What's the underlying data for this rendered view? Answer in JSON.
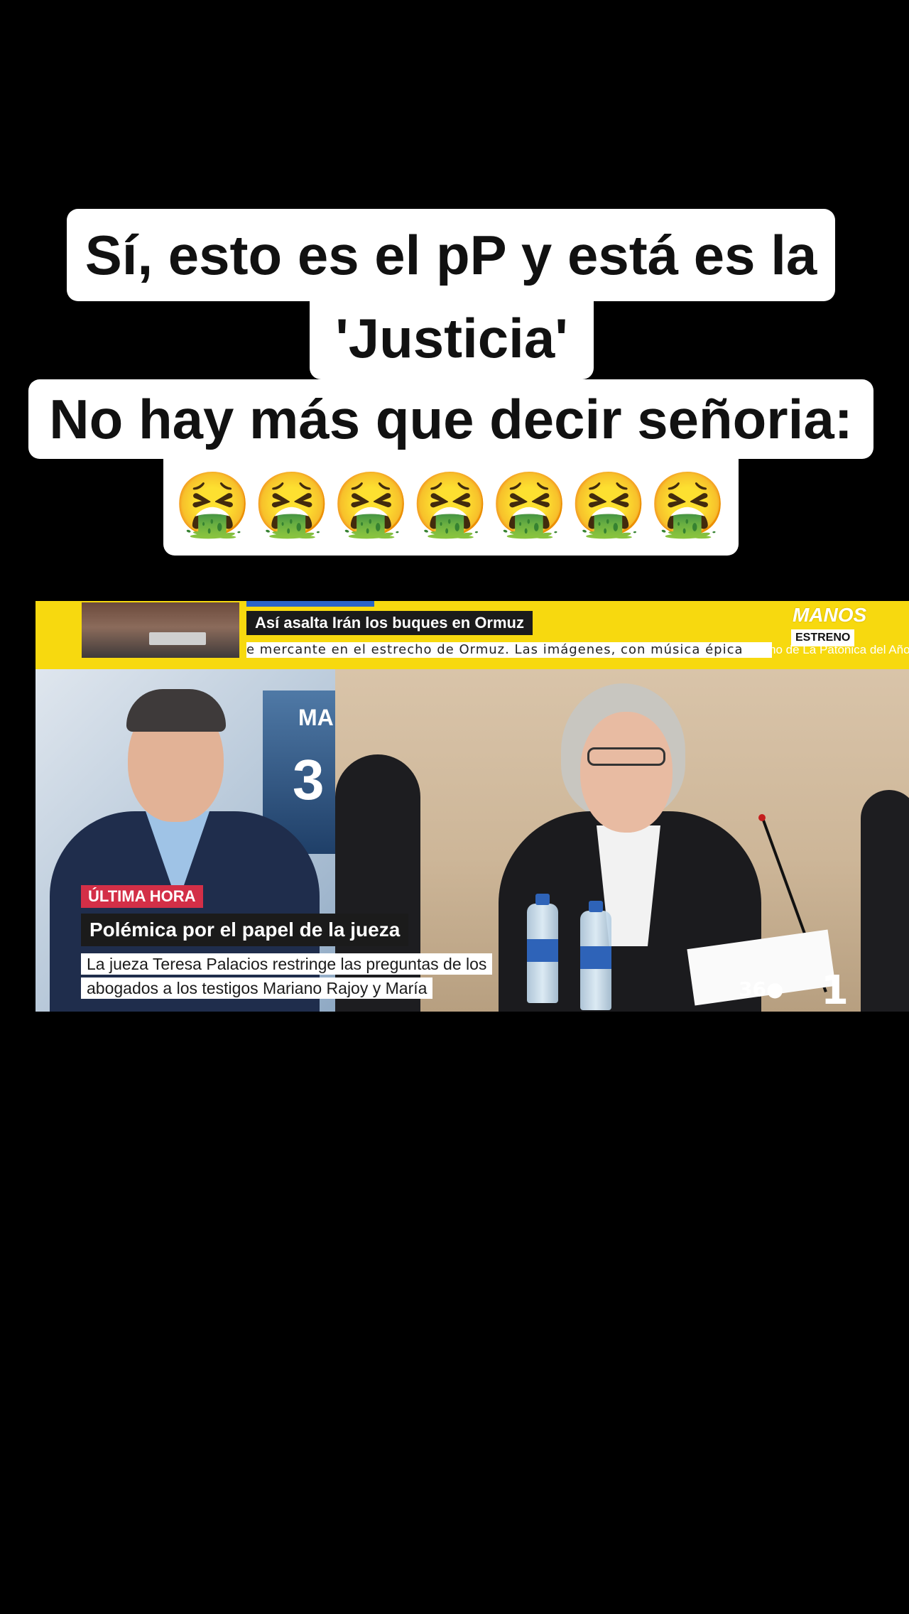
{
  "caption": {
    "line1": "Sí, esto es el pP y está es la",
    "line2": "'Justicia'",
    "line3": "No hay más que decir señoria:",
    "line4": "🤮🤮🤮🤮🤮🤮🤮"
  },
  "video": {
    "ticker": {
      "headline": "Así asalta Irán los buques en Ormuz",
      "scroll": "e mercante en el estrecho de Ormuz. Las imágenes, con música épica",
      "scroll_tail": "a ritmo de La Patónica del Año.",
      "brand": "MANOS",
      "badge": "ESTRENO"
    },
    "studio_text": "MA",
    "studio_num": "3",
    "lower_third": {
      "tag": "ÚLTIMA HORA",
      "title": "Polémica por el papel de la jueza",
      "subtitle": "La jueza Teresa Palacios restringe las preguntas de los abogados a los testigos Mariano Rajoy y María"
    },
    "channel_logo_360": "36●",
    "channel_logo_1": "1"
  }
}
